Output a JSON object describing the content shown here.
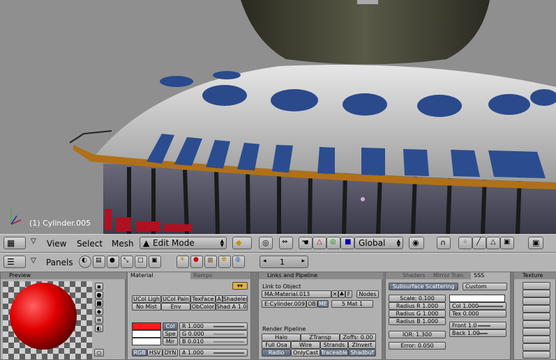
{
  "viewport": {
    "object_label": "(1) Cylinder.005"
  },
  "view_header": {
    "menus": [
      "View",
      "Select",
      "Mesh"
    ],
    "mode": "Edit Mode",
    "orientation": "Global"
  },
  "buttons_header": {
    "panels_label": "Panels",
    "frame": "1"
  },
  "preview": {
    "title": "Preview"
  },
  "material": {
    "tabs": [
      "Material",
      "Ramps"
    ],
    "row1": [
      "UCol Ligh",
      "UCol Pain",
      "TexFace",
      "A",
      "Shadeles"
    ],
    "row2": [
      "No Mist",
      "Env",
      "ObColor",
      "Shad A 1.00"
    ],
    "color_tabs": [
      "Col",
      "Spe",
      "Mir"
    ],
    "rgb": [
      "R 1.000",
      "G 0.000",
      "B 0.010"
    ],
    "modes": [
      "RGB",
      "HSV",
      "DYN"
    ],
    "alpha": "A 1.000"
  },
  "links": {
    "title": "Links and Pipeline",
    "link_to_object": "Link to Object",
    "ma_field": "MA:Material.013",
    "f_btn": "F",
    "nodes_btn": "Nodes",
    "me_field": "E:Cylinder.009",
    "ob_btn": "OB",
    "me_btn": "ME",
    "mat_count": "5 Mat 1",
    "render_pipeline": "Render Pipeline",
    "pipe_row1": [
      "Halo",
      "ZTransp",
      "Zoffs: 0.00"
    ],
    "pipe_row2": [
      "Full Osa",
      "Wire",
      "Strands",
      "ZInvert"
    ],
    "pipe_row3": [
      "Radio",
      "OnlyCast",
      "Traceable",
      "Shadbuf"
    ]
  },
  "sss": {
    "tabs": [
      "Shaders",
      "Mirror Tran",
      "SSS"
    ],
    "toggle": "Subsurface Scattering",
    "preset": "Custom",
    "fields": [
      "Scale: 0.100",
      "Radius R 1.000",
      "Radius G 1.000",
      "Radius B 1.000"
    ],
    "col": "Col 1.000",
    "tex": "Tex 0.000",
    "front": "Front 1.0",
    "back": "Back 1.00",
    "ior": "IOR: 1.300",
    "error": "Error: 0.050"
  },
  "texture": {
    "title": "Texture"
  },
  "colors": {
    "material_col": "#ff1a1a",
    "sphere": "#e00000"
  }
}
